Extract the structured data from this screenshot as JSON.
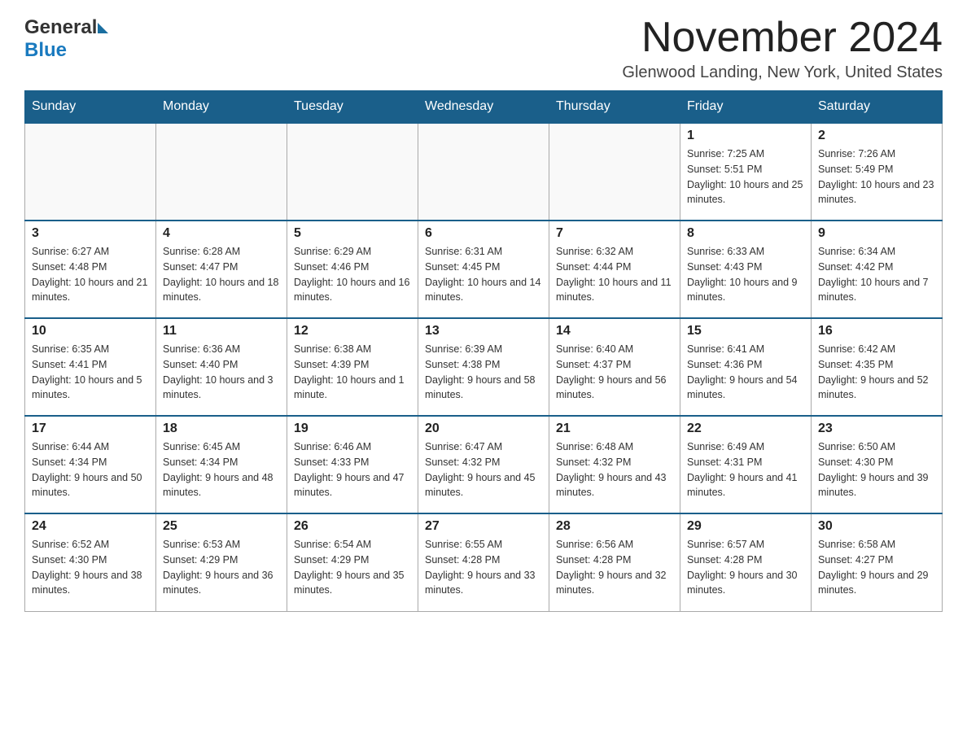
{
  "header": {
    "logo_general": "General",
    "logo_blue": "Blue",
    "month_title": "November 2024",
    "location": "Glenwood Landing, New York, United States"
  },
  "weekdays": [
    "Sunday",
    "Monday",
    "Tuesday",
    "Wednesday",
    "Thursday",
    "Friday",
    "Saturday"
  ],
  "weeks": [
    [
      {
        "day": "",
        "sunrise": "",
        "sunset": "",
        "daylight": ""
      },
      {
        "day": "",
        "sunrise": "",
        "sunset": "",
        "daylight": ""
      },
      {
        "day": "",
        "sunrise": "",
        "sunset": "",
        "daylight": ""
      },
      {
        "day": "",
        "sunrise": "",
        "sunset": "",
        "daylight": ""
      },
      {
        "day": "",
        "sunrise": "",
        "sunset": "",
        "daylight": ""
      },
      {
        "day": "1",
        "sunrise": "Sunrise: 7:25 AM",
        "sunset": "Sunset: 5:51 PM",
        "daylight": "Daylight: 10 hours and 25 minutes."
      },
      {
        "day": "2",
        "sunrise": "Sunrise: 7:26 AM",
        "sunset": "Sunset: 5:49 PM",
        "daylight": "Daylight: 10 hours and 23 minutes."
      }
    ],
    [
      {
        "day": "3",
        "sunrise": "Sunrise: 6:27 AM",
        "sunset": "Sunset: 4:48 PM",
        "daylight": "Daylight: 10 hours and 21 minutes."
      },
      {
        "day": "4",
        "sunrise": "Sunrise: 6:28 AM",
        "sunset": "Sunset: 4:47 PM",
        "daylight": "Daylight: 10 hours and 18 minutes."
      },
      {
        "day": "5",
        "sunrise": "Sunrise: 6:29 AM",
        "sunset": "Sunset: 4:46 PM",
        "daylight": "Daylight: 10 hours and 16 minutes."
      },
      {
        "day": "6",
        "sunrise": "Sunrise: 6:31 AM",
        "sunset": "Sunset: 4:45 PM",
        "daylight": "Daylight: 10 hours and 14 minutes."
      },
      {
        "day": "7",
        "sunrise": "Sunrise: 6:32 AM",
        "sunset": "Sunset: 4:44 PM",
        "daylight": "Daylight: 10 hours and 11 minutes."
      },
      {
        "day": "8",
        "sunrise": "Sunrise: 6:33 AM",
        "sunset": "Sunset: 4:43 PM",
        "daylight": "Daylight: 10 hours and 9 minutes."
      },
      {
        "day": "9",
        "sunrise": "Sunrise: 6:34 AM",
        "sunset": "Sunset: 4:42 PM",
        "daylight": "Daylight: 10 hours and 7 minutes."
      }
    ],
    [
      {
        "day": "10",
        "sunrise": "Sunrise: 6:35 AM",
        "sunset": "Sunset: 4:41 PM",
        "daylight": "Daylight: 10 hours and 5 minutes."
      },
      {
        "day": "11",
        "sunrise": "Sunrise: 6:36 AM",
        "sunset": "Sunset: 4:40 PM",
        "daylight": "Daylight: 10 hours and 3 minutes."
      },
      {
        "day": "12",
        "sunrise": "Sunrise: 6:38 AM",
        "sunset": "Sunset: 4:39 PM",
        "daylight": "Daylight: 10 hours and 1 minute."
      },
      {
        "day": "13",
        "sunrise": "Sunrise: 6:39 AM",
        "sunset": "Sunset: 4:38 PM",
        "daylight": "Daylight: 9 hours and 58 minutes."
      },
      {
        "day": "14",
        "sunrise": "Sunrise: 6:40 AM",
        "sunset": "Sunset: 4:37 PM",
        "daylight": "Daylight: 9 hours and 56 minutes."
      },
      {
        "day": "15",
        "sunrise": "Sunrise: 6:41 AM",
        "sunset": "Sunset: 4:36 PM",
        "daylight": "Daylight: 9 hours and 54 minutes."
      },
      {
        "day": "16",
        "sunrise": "Sunrise: 6:42 AM",
        "sunset": "Sunset: 4:35 PM",
        "daylight": "Daylight: 9 hours and 52 minutes."
      }
    ],
    [
      {
        "day": "17",
        "sunrise": "Sunrise: 6:44 AM",
        "sunset": "Sunset: 4:34 PM",
        "daylight": "Daylight: 9 hours and 50 minutes."
      },
      {
        "day": "18",
        "sunrise": "Sunrise: 6:45 AM",
        "sunset": "Sunset: 4:34 PM",
        "daylight": "Daylight: 9 hours and 48 minutes."
      },
      {
        "day": "19",
        "sunrise": "Sunrise: 6:46 AM",
        "sunset": "Sunset: 4:33 PM",
        "daylight": "Daylight: 9 hours and 47 minutes."
      },
      {
        "day": "20",
        "sunrise": "Sunrise: 6:47 AM",
        "sunset": "Sunset: 4:32 PM",
        "daylight": "Daylight: 9 hours and 45 minutes."
      },
      {
        "day": "21",
        "sunrise": "Sunrise: 6:48 AM",
        "sunset": "Sunset: 4:32 PM",
        "daylight": "Daylight: 9 hours and 43 minutes."
      },
      {
        "day": "22",
        "sunrise": "Sunrise: 6:49 AM",
        "sunset": "Sunset: 4:31 PM",
        "daylight": "Daylight: 9 hours and 41 minutes."
      },
      {
        "day": "23",
        "sunrise": "Sunrise: 6:50 AM",
        "sunset": "Sunset: 4:30 PM",
        "daylight": "Daylight: 9 hours and 39 minutes."
      }
    ],
    [
      {
        "day": "24",
        "sunrise": "Sunrise: 6:52 AM",
        "sunset": "Sunset: 4:30 PM",
        "daylight": "Daylight: 9 hours and 38 minutes."
      },
      {
        "day": "25",
        "sunrise": "Sunrise: 6:53 AM",
        "sunset": "Sunset: 4:29 PM",
        "daylight": "Daylight: 9 hours and 36 minutes."
      },
      {
        "day": "26",
        "sunrise": "Sunrise: 6:54 AM",
        "sunset": "Sunset: 4:29 PM",
        "daylight": "Daylight: 9 hours and 35 minutes."
      },
      {
        "day": "27",
        "sunrise": "Sunrise: 6:55 AM",
        "sunset": "Sunset: 4:28 PM",
        "daylight": "Daylight: 9 hours and 33 minutes."
      },
      {
        "day": "28",
        "sunrise": "Sunrise: 6:56 AM",
        "sunset": "Sunset: 4:28 PM",
        "daylight": "Daylight: 9 hours and 32 minutes."
      },
      {
        "day": "29",
        "sunrise": "Sunrise: 6:57 AM",
        "sunset": "Sunset: 4:28 PM",
        "daylight": "Daylight: 9 hours and 30 minutes."
      },
      {
        "day": "30",
        "sunrise": "Sunrise: 6:58 AM",
        "sunset": "Sunset: 4:27 PM",
        "daylight": "Daylight: 9 hours and 29 minutes."
      }
    ]
  ]
}
